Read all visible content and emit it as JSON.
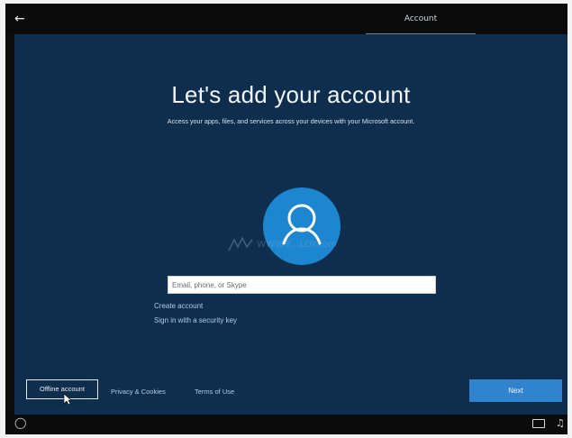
{
  "header": {
    "back_icon": "back-arrow-icon",
    "tab_label": "Account"
  },
  "main": {
    "title": "Let's add your account",
    "subtitle": "Access your apps, files, and services across your devices with your Microsoft account.",
    "avatar_icon": "user-icon",
    "watermark_text": "WWW.E...LOY.com",
    "email_placeholder": "Email, phone, or Skype",
    "links": {
      "create_account": "Create account",
      "security_key": "Sign in with a security key"
    }
  },
  "footer": {
    "offline_account": "Offline account",
    "privacy": "Privacy & Cookies",
    "terms": "Terms of Use",
    "next": "Next"
  },
  "taskbar": {
    "ease_of_access_icon": "ease-of-access-icon",
    "keyboard_icon": "keyboard-icon",
    "volume_icon": "volume-icon"
  },
  "colors": {
    "panel_bg": "#0f2d4d",
    "accent": "#2f83cf",
    "avatar": "#1c86d1",
    "link": "#aacdf0"
  }
}
